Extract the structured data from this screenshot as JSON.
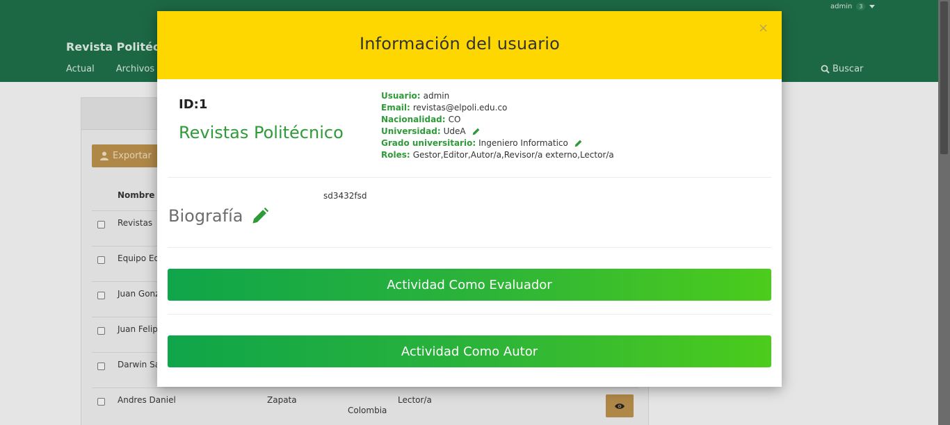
{
  "header": {
    "user_name": "admin",
    "notification_count": "3",
    "site_title": "Revista Politécn",
    "nav": [
      {
        "label": "Actual"
      },
      {
        "label": "Archivos"
      }
    ],
    "search_label": "Buscar"
  },
  "panel": {
    "export_label": "Exportar",
    "column_name": "Nombre",
    "rows": [
      {
        "name": "Revistas",
        "c2": "",
        "c3": "",
        "c4": ""
      },
      {
        "name": "Equipo Ed",
        "c2": "",
        "c3": "",
        "c4": ""
      },
      {
        "name": "Juan Gonz",
        "c2": "",
        "c3": "",
        "c4": ""
      },
      {
        "name": "Juan Felip",
        "c2": "",
        "c3": "",
        "c4": ""
      },
      {
        "name": "Darwin Sa",
        "c2": "",
        "c3": "",
        "c4": ""
      },
      {
        "name": "Andres Daniel",
        "c2": "Zapata",
        "c3": "Colombia",
        "c4": "Lector/a"
      }
    ]
  },
  "modal": {
    "title": "Información del usuario",
    "close": "×",
    "id_label": "ID:1",
    "journal": "Revistas Politécnico",
    "fields": {
      "usuario": {
        "label": "Usuario:",
        "value": "admin"
      },
      "email": {
        "label": "Email:",
        "value": "revistas@elpoli.edu.co"
      },
      "nacionalidad": {
        "label": "Nacionalidad:",
        "value": "CO"
      },
      "universidad": {
        "label": "Universidad:",
        "value": "UdeA"
      },
      "grado": {
        "label": "Grado universitario:",
        "value": "Ingeniero Informatico"
      },
      "roles": {
        "label": "Roles:",
        "value": "Gestor,Editor,Autor/a,Revisor/a externo,Lector/a"
      }
    },
    "bio_title": "Biografía",
    "bio_text": "sd3432fsd",
    "btn_evaluador": "Actividad Como Evaluador",
    "btn_autor": "Actividad Como Autor"
  },
  "colors": {
    "header_green": "#1e6b46",
    "modal_header": "#ffd700",
    "accent_green": "#2f9a38",
    "button_gold": "#b38b4a"
  },
  "icons": [
    "caret-down-icon",
    "search-icon",
    "user-export-icon",
    "eye-icon",
    "pencil-icon",
    "close-icon"
  ]
}
